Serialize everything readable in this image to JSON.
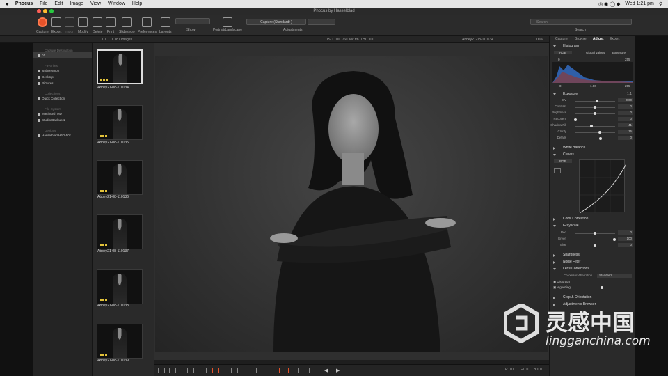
{
  "menubar": {
    "apple": "",
    "items": [
      "Phocus",
      "File",
      "Edit",
      "Image",
      "View",
      "Window",
      "Help"
    ],
    "clock": "Wed 1:21 pm"
  },
  "window": {
    "title": "Phocus by Hasselblad"
  },
  "toolbar": {
    "buttons": [
      "Capture",
      "Export",
      "Import",
      "Modify",
      "Delete",
      "Print",
      "Slideshow",
      "Preferences",
      "Layouts"
    ],
    "show_label": "Show",
    "portrait_label": "Portrait/Landscape",
    "adjust_label": "Adjustments",
    "search_label": "Search",
    "capture_mode": "Capture (Standard+)",
    "search_placeholder": "Search"
  },
  "browser": {
    "image_count": "1 181 images",
    "folder": "01",
    "sections": [
      {
        "title": "Capture Destination",
        "items": [
          {
            "label": "01",
            "selected": true
          }
        ]
      },
      {
        "title": "Favorites",
        "items": [
          {
            "label": "anthonymon"
          },
          {
            "label": "Desktop"
          },
          {
            "label": "Pictures"
          }
        ]
      },
      {
        "title": "Collections",
        "items": [
          {
            "label": "Quick Collection"
          }
        ]
      },
      {
        "title": "File System",
        "items": [
          {
            "label": "Macintosh HD"
          },
          {
            "label": "Studio Backup 1"
          }
        ]
      },
      {
        "title": "Devices",
        "items": [
          {
            "label": "Hasselblad H6D-50c"
          }
        ]
      }
    ]
  },
  "thumbnails": [
    {
      "name": "Abbey21-08-110134",
      "selected": true
    },
    {
      "name": "Abbey21-08-110135"
    },
    {
      "name": "Abbey21-08-110136"
    },
    {
      "name": "Abbey21-08-110137"
    },
    {
      "name": "Abbey21-08-110138"
    },
    {
      "name": "Abbey21-08-110139"
    }
  ],
  "viewer": {
    "exif": "ISO 100  1/60 sec  f/8.0  HC 100",
    "filename": "Abbey21-08-110134",
    "zoom": "16%",
    "footer": {
      "r": "R 0.0",
      "g": "G 0.0",
      "b": "B 0.0"
    }
  },
  "right": {
    "tabs": [
      "Capture",
      "Browse",
      "Adjust",
      "Export"
    ],
    "histogram": {
      "title": "Histogram",
      "mode": "RGB",
      "opt1": "Global values",
      "opt2": "Exposure",
      "min": "0",
      "max": "255",
      "lo": "0",
      "mid": "1.00",
      "hi": "255"
    },
    "exposure": {
      "title": "Exposure",
      "value": "1:1",
      "sliders": [
        {
          "label": "EV",
          "val": "0.00",
          "pos": 0.55
        },
        {
          "label": "Contrast",
          "val": "0",
          "pos": 0.5
        },
        {
          "label": "Brightness",
          "val": "0",
          "pos": 0.5
        },
        {
          "label": "Recovery",
          "val": "0",
          "pos": 0.02
        },
        {
          "label": "Shadow Fill",
          "val": "41",
          "pos": 0.42
        },
        {
          "label": "Clarity",
          "val": "15",
          "pos": 0.62
        },
        {
          "label": "Details",
          "val": "0",
          "pos": 0.64
        }
      ]
    },
    "panels_closed": [
      "White Balance"
    ],
    "curves": {
      "title": "Curves",
      "mode": "RGB"
    },
    "color_correction": "Color Correction",
    "grayscale": {
      "title": "Grayscale",
      "sliders": [
        {
          "label": "Red",
          "val": "0",
          "pos": 0.5
        },
        {
          "label": "Green",
          "val": "100",
          "pos": 0.98
        },
        {
          "label": "Blue",
          "val": "0",
          "pos": 0.5
        }
      ]
    },
    "sharpness": "Sharpness",
    "noise": "Noise Filter",
    "lens": {
      "title": "Lens Corrections",
      "ca_label": "Chromatic Aberration",
      "ca_val": "Standard",
      "distortion": "Distortion",
      "vignetting": "Vignetting",
      "vig_pos": 0.5
    },
    "crop": "Crop & Orientation",
    "adj_browser": "Adjustments Browser"
  },
  "watermark": {
    "cn": "灵感中国",
    "url": "lingganchina.com"
  }
}
